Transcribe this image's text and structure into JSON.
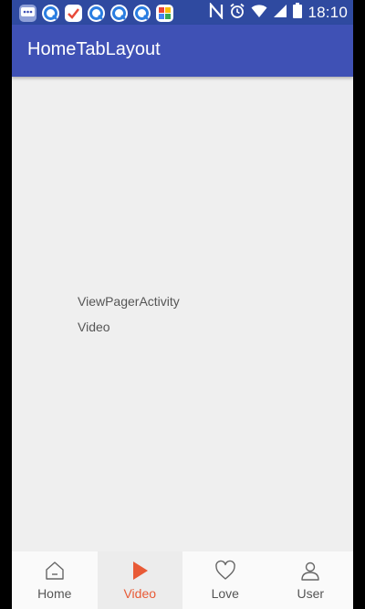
{
  "status_bar": {
    "time": "18:10",
    "notification_icons": [
      "more-icon",
      "browser-icon",
      "tick-app-icon",
      "browser-icon",
      "browser-icon",
      "browser-icon",
      "photos-icon"
    ],
    "system_icons": [
      "nfc-icon",
      "alarm-icon",
      "wifi-icon",
      "signal-icon",
      "battery-icon"
    ]
  },
  "app_bar": {
    "title": "HomeTabLayout"
  },
  "content": {
    "activity_label": "ViewPagerActivity",
    "page_label": "Video"
  },
  "bottom_nav": {
    "items": [
      {
        "label": "Home",
        "icon": "home-icon",
        "active": false
      },
      {
        "label": "Video",
        "icon": "play-icon",
        "active": true
      },
      {
        "label": "Love",
        "icon": "heart-icon",
        "active": false
      },
      {
        "label": "User",
        "icon": "user-icon",
        "active": false
      }
    ]
  },
  "colors": {
    "status_bar": "#2f4aa0",
    "app_bar": "#3f51b5",
    "accent": "#e85a36",
    "background": "#efefef"
  }
}
